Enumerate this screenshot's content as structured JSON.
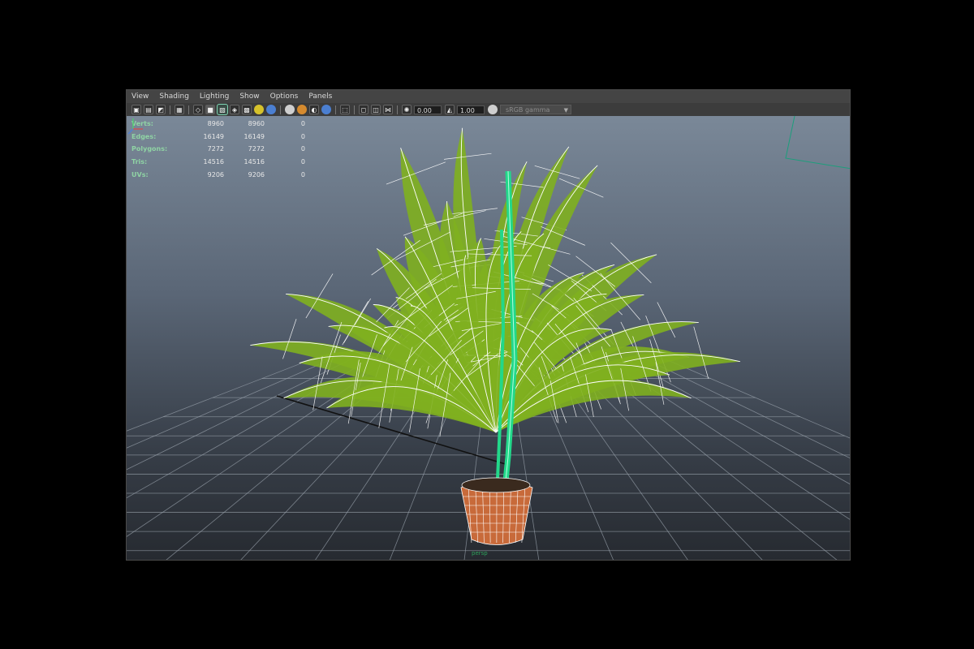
{
  "menu": [
    "View",
    "Shading",
    "Lighting",
    "Show",
    "Options",
    "Panels"
  ],
  "toolbar": {
    "exposure_value": "0.00",
    "gamma_value": "1.00",
    "color_space": "sRGB gamma"
  },
  "hud": {
    "rows": [
      {
        "label": "Verts:",
        "v1": "8960",
        "v2": "8960",
        "v3": "0"
      },
      {
        "label": "Edges:",
        "v1": "16149",
        "v2": "16149",
        "v3": "0"
      },
      {
        "label": "Polygons:",
        "v1": "7272",
        "v2": "7272",
        "v3": "0"
      },
      {
        "label": "Tris:",
        "v1": "14516",
        "v2": "14516",
        "v3": "0"
      },
      {
        "label": "UVs:",
        "v1": "9206",
        "v2": "9206",
        "v3": "0"
      }
    ]
  },
  "camera_label": "persp",
  "colors": {
    "wireframe": "#ffffff",
    "leaf": "#7fb01f",
    "stem": "#22d88a",
    "pot": "#c86a3a"
  }
}
